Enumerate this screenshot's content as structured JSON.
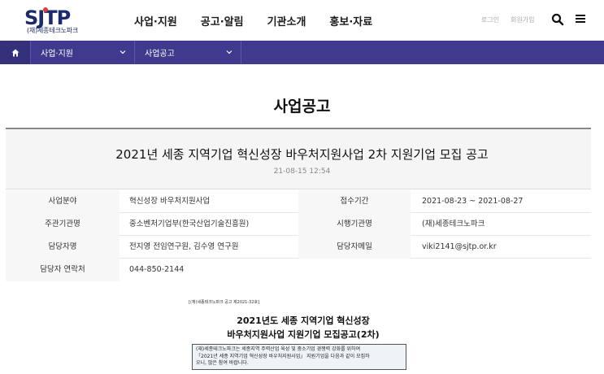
{
  "header": {
    "logo_sub": "(재)세종테크노파크",
    "nav": [
      "사업·지원",
      "공고·알림",
      "기관소개",
      "홍보·자료"
    ],
    "login": "로그인",
    "join": "회원가입",
    "icons": {
      "search": "search-icon",
      "menu": "hamburger-menu-icon"
    }
  },
  "colors": {
    "brand_navy": "#1d2a6b",
    "brand_purple": "#3f3a8e",
    "accent_red": "#e03c31"
  },
  "breadcrumb": {
    "home_icon": "home-icon",
    "level1": "사업·지원",
    "level2": "사업공고"
  },
  "page": {
    "title": "사업공고"
  },
  "post": {
    "title": "2021년 세종 지역기업 혁신성장 바우처지원사업 2차 지원기업 모집 공고",
    "date": "21-08-15 12:54"
  },
  "info": {
    "rows": [
      {
        "label_a": "사업분야",
        "value_a": "혁신성장 바우처지원사업",
        "label_b": "접수기간",
        "value_b": "2021-08-23 ~ 2021-08-27"
      },
      {
        "label_a": "주관기관명",
        "value_a": "중소벤처기업부(한국산업기술진흥원)",
        "label_b": "시행기관명",
        "value_b": "(재)세종테크노파크"
      },
      {
        "label_a": "담당자명",
        "value_a": "전지영 전임연구원, 김수영 연구원",
        "label_b": "담당자메일",
        "value_b": "viki2141@sjtp.or.kr"
      },
      {
        "label_a": "담당자 연락처",
        "value_a": "044-850-2144"
      }
    ]
  },
  "doc": {
    "number": "[(재)세종테크노파크 공고 제2021-32호]",
    "title_line1": "2021년도 세종 지역기업 혁신성장",
    "title_line2": "바우처지원사업 지원기업 모집공고(2차)",
    "box_line1": "(재)세종테크노파크는 세종지역 주력산업 육성 및 중소기업 경쟁력 강화를 위하여",
    "box_line2": "「2021년 세종 지역기업 혁신성장 바우처지원사업」 지원기업을 다음과 같이 모집하",
    "box_line3": "오니, 많은 참여 바랍니다."
  }
}
